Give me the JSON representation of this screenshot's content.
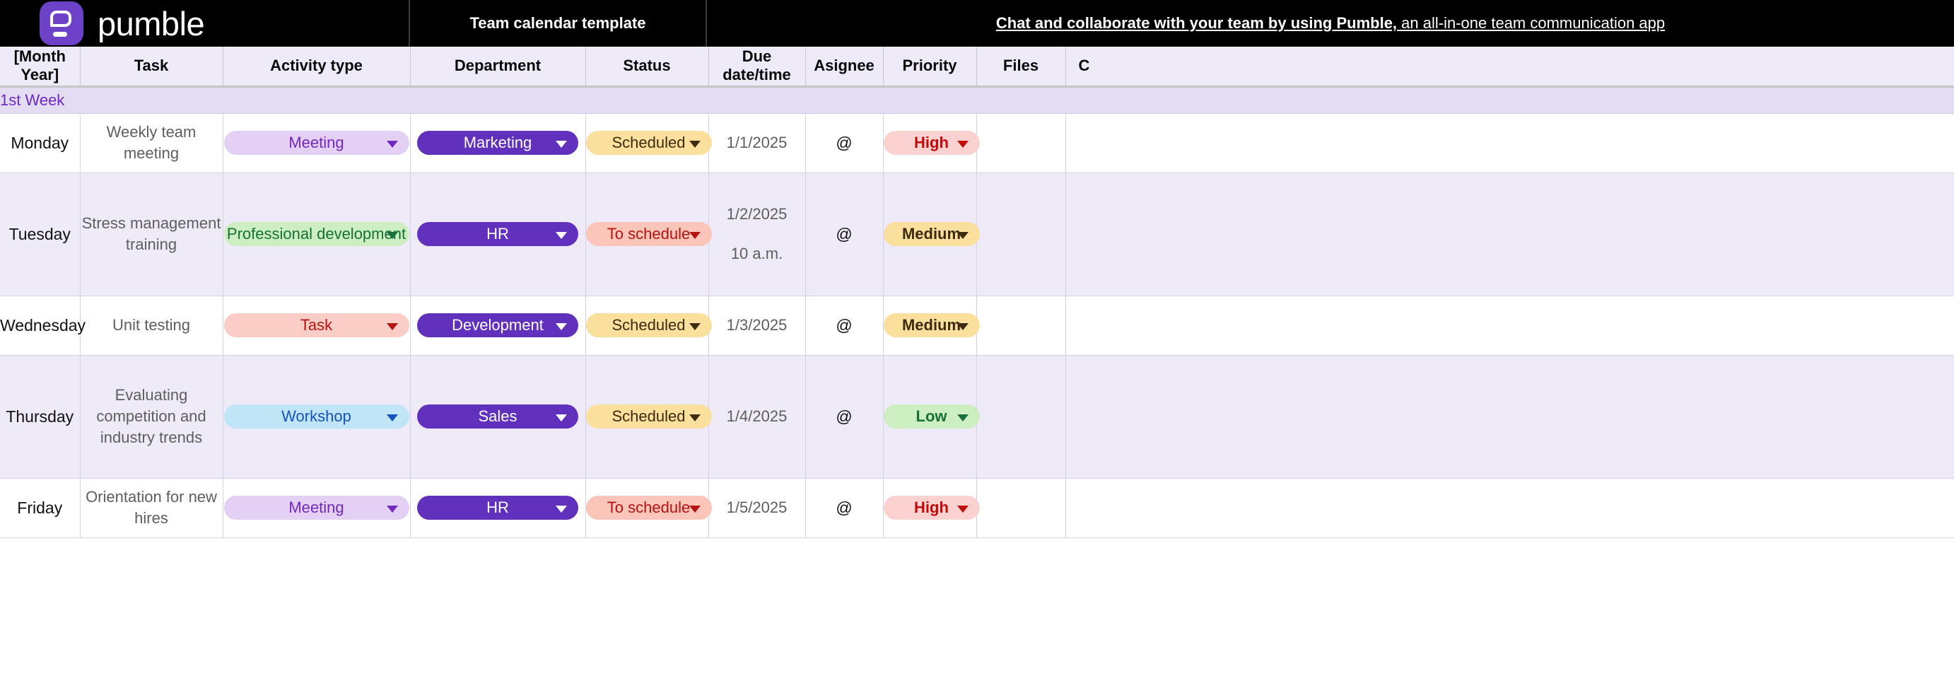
{
  "banner": {
    "brand": "pumble",
    "logo_icon": "pumble-speech-bubble-logo",
    "title": "Team calendar template",
    "link_strong": "Chat and collaborate with your team by using Pumble,",
    "link_tail": " an all-in-one team communication app"
  },
  "table": {
    "headers": [
      "[Month Year]",
      "Task",
      "Activity type",
      "Department",
      "Status",
      "Due date/time",
      "Asignee",
      "Priority",
      "Files",
      "C"
    ],
    "week_label": "1st Week",
    "rows": [
      {
        "day": "Monday",
        "task": "Weekly team meeting",
        "activity": {
          "label": "Meeting",
          "style": "c-meeting"
        },
        "department": {
          "label": "Marketing",
          "style": "c-dept"
        },
        "status": {
          "label": "Scheduled",
          "style": "c-scheduled"
        },
        "date": "1/1/2025",
        "time": "",
        "assignee": "@",
        "priority": {
          "label": "High",
          "style": "c-high"
        },
        "files": "",
        "comments": ""
      },
      {
        "day": "Tuesday",
        "task": "Stress management training",
        "activity": {
          "label": "Professional development",
          "style": "c-prof"
        },
        "department": {
          "label": "HR",
          "style": "c-dept"
        },
        "status": {
          "label": "To schedule",
          "style": "c-toschedule"
        },
        "date": "1/2/2025",
        "time": "10 a.m.",
        "assignee": "@",
        "priority": {
          "label": "Medium",
          "style": "c-medium"
        },
        "files": "",
        "comments": ""
      },
      {
        "day": "Wednesday",
        "task": "Unit testing",
        "activity": {
          "label": "Task",
          "style": "c-task"
        },
        "department": {
          "label": "Development",
          "style": "c-dept"
        },
        "status": {
          "label": "Scheduled",
          "style": "c-scheduled"
        },
        "date": "1/3/2025",
        "time": "",
        "assignee": "@",
        "priority": {
          "label": "Medium",
          "style": "c-medium"
        },
        "files": "",
        "comments": ""
      },
      {
        "day": "Thursday",
        "task": "Evaluating competition and industry trends",
        "activity": {
          "label": "Workshop",
          "style": "c-workshop"
        },
        "department": {
          "label": "Sales",
          "style": "c-dept"
        },
        "status": {
          "label": "Scheduled",
          "style": "c-scheduled"
        },
        "date": "1/4/2025",
        "time": "",
        "assignee": "@",
        "priority": {
          "label": "Low",
          "style": "c-low"
        },
        "files": "",
        "comments": ""
      },
      {
        "day": "Friday",
        "task": "Orientation for new hires",
        "activity": {
          "label": "Meeting",
          "style": "c-meeting"
        },
        "department": {
          "label": "HR",
          "style": "c-dept"
        },
        "status": {
          "label": "To schedule",
          "style": "c-toschedule"
        },
        "date": "1/5/2025",
        "time": "",
        "assignee": "@",
        "priority": {
          "label": "High",
          "style": "c-high"
        },
        "files": "",
        "comments": ""
      }
    ]
  },
  "colors": {
    "brand_purple": "#6131be",
    "banner_bg": "#000000",
    "header_bg": "#eeeaf7",
    "week_bg": "#e4dcf3",
    "alt_row_bg": "#eeeaf7",
    "week_text": "#6b28c4"
  }
}
